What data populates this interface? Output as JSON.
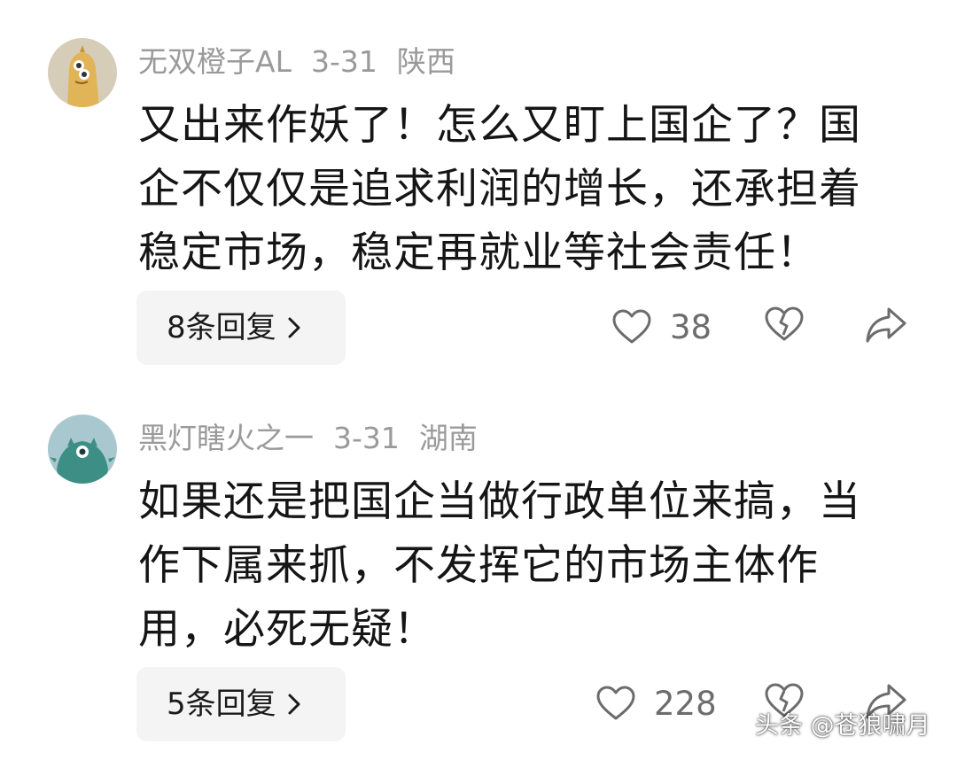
{
  "comments": [
    {
      "username": "无双橙子AL",
      "date": "3-31",
      "location": "陕西",
      "lines": [
        "又出来作妖了！怎么又盯上国企了？国",
        "企不仅仅是追求利润的增长，还承担着",
        "稳定市场，稳定再就业等社会责任！"
      ],
      "reply_label": "8条回复",
      "like_count": "38",
      "avatar_color": "#dcc59a"
    },
    {
      "username": "黑灯瞎火之一",
      "date": "3-31",
      "location": "湖南",
      "lines": [
        "如果还是把国企当做行政单位来搞，当",
        "作下属来抓，不发挥它的市场主体作",
        "用，必死无疑！"
      ],
      "reply_label": "5条回复",
      "like_count": "228",
      "avatar_color": "#a9c7cf"
    }
  ],
  "icons": {
    "reply_chevron": "chevron-right-icon",
    "like": "heart-icon",
    "dislike": "broken-heart-icon",
    "share": "share-icon"
  },
  "watermark": "头条 @苍狼啸月"
}
